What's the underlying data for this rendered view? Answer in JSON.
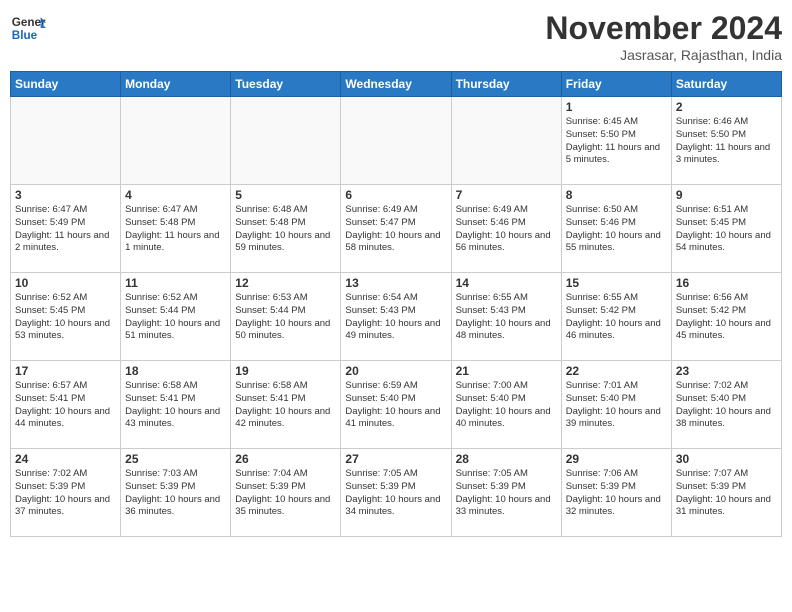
{
  "header": {
    "logo_line1": "General",
    "logo_line2": "Blue",
    "month": "November 2024",
    "location": "Jasrasar, Rajasthan, India"
  },
  "weekdays": [
    "Sunday",
    "Monday",
    "Tuesday",
    "Wednesday",
    "Thursday",
    "Friday",
    "Saturday"
  ],
  "weeks": [
    [
      {
        "day": "",
        "info": ""
      },
      {
        "day": "",
        "info": ""
      },
      {
        "day": "",
        "info": ""
      },
      {
        "day": "",
        "info": ""
      },
      {
        "day": "",
        "info": ""
      },
      {
        "day": "1",
        "info": "Sunrise: 6:45 AM\nSunset: 5:50 PM\nDaylight: 11 hours\nand 5 minutes."
      },
      {
        "day": "2",
        "info": "Sunrise: 6:46 AM\nSunset: 5:50 PM\nDaylight: 11 hours\nand 3 minutes."
      }
    ],
    [
      {
        "day": "3",
        "info": "Sunrise: 6:47 AM\nSunset: 5:49 PM\nDaylight: 11 hours\nand 2 minutes."
      },
      {
        "day": "4",
        "info": "Sunrise: 6:47 AM\nSunset: 5:48 PM\nDaylight: 11 hours\nand 1 minute."
      },
      {
        "day": "5",
        "info": "Sunrise: 6:48 AM\nSunset: 5:48 PM\nDaylight: 10 hours\nand 59 minutes."
      },
      {
        "day": "6",
        "info": "Sunrise: 6:49 AM\nSunset: 5:47 PM\nDaylight: 10 hours\nand 58 minutes."
      },
      {
        "day": "7",
        "info": "Sunrise: 6:49 AM\nSunset: 5:46 PM\nDaylight: 10 hours\nand 56 minutes."
      },
      {
        "day": "8",
        "info": "Sunrise: 6:50 AM\nSunset: 5:46 PM\nDaylight: 10 hours\nand 55 minutes."
      },
      {
        "day": "9",
        "info": "Sunrise: 6:51 AM\nSunset: 5:45 PM\nDaylight: 10 hours\nand 54 minutes."
      }
    ],
    [
      {
        "day": "10",
        "info": "Sunrise: 6:52 AM\nSunset: 5:45 PM\nDaylight: 10 hours\nand 53 minutes."
      },
      {
        "day": "11",
        "info": "Sunrise: 6:52 AM\nSunset: 5:44 PM\nDaylight: 10 hours\nand 51 minutes."
      },
      {
        "day": "12",
        "info": "Sunrise: 6:53 AM\nSunset: 5:44 PM\nDaylight: 10 hours\nand 50 minutes."
      },
      {
        "day": "13",
        "info": "Sunrise: 6:54 AM\nSunset: 5:43 PM\nDaylight: 10 hours\nand 49 minutes."
      },
      {
        "day": "14",
        "info": "Sunrise: 6:55 AM\nSunset: 5:43 PM\nDaylight: 10 hours\nand 48 minutes."
      },
      {
        "day": "15",
        "info": "Sunrise: 6:55 AM\nSunset: 5:42 PM\nDaylight: 10 hours\nand 46 minutes."
      },
      {
        "day": "16",
        "info": "Sunrise: 6:56 AM\nSunset: 5:42 PM\nDaylight: 10 hours\nand 45 minutes."
      }
    ],
    [
      {
        "day": "17",
        "info": "Sunrise: 6:57 AM\nSunset: 5:41 PM\nDaylight: 10 hours\nand 44 minutes."
      },
      {
        "day": "18",
        "info": "Sunrise: 6:58 AM\nSunset: 5:41 PM\nDaylight: 10 hours\nand 43 minutes."
      },
      {
        "day": "19",
        "info": "Sunrise: 6:58 AM\nSunset: 5:41 PM\nDaylight: 10 hours\nand 42 minutes."
      },
      {
        "day": "20",
        "info": "Sunrise: 6:59 AM\nSunset: 5:40 PM\nDaylight: 10 hours\nand 41 minutes."
      },
      {
        "day": "21",
        "info": "Sunrise: 7:00 AM\nSunset: 5:40 PM\nDaylight: 10 hours\nand 40 minutes."
      },
      {
        "day": "22",
        "info": "Sunrise: 7:01 AM\nSunset: 5:40 PM\nDaylight: 10 hours\nand 39 minutes."
      },
      {
        "day": "23",
        "info": "Sunrise: 7:02 AM\nSunset: 5:40 PM\nDaylight: 10 hours\nand 38 minutes."
      }
    ],
    [
      {
        "day": "24",
        "info": "Sunrise: 7:02 AM\nSunset: 5:39 PM\nDaylight: 10 hours\nand 37 minutes."
      },
      {
        "day": "25",
        "info": "Sunrise: 7:03 AM\nSunset: 5:39 PM\nDaylight: 10 hours\nand 36 minutes."
      },
      {
        "day": "26",
        "info": "Sunrise: 7:04 AM\nSunset: 5:39 PM\nDaylight: 10 hours\nand 35 minutes."
      },
      {
        "day": "27",
        "info": "Sunrise: 7:05 AM\nSunset: 5:39 PM\nDaylight: 10 hours\nand 34 minutes."
      },
      {
        "day": "28",
        "info": "Sunrise: 7:05 AM\nSunset: 5:39 PM\nDaylight: 10 hours\nand 33 minutes."
      },
      {
        "day": "29",
        "info": "Sunrise: 7:06 AM\nSunset: 5:39 PM\nDaylight: 10 hours\nand 32 minutes."
      },
      {
        "day": "30",
        "info": "Sunrise: 7:07 AM\nSunset: 5:39 PM\nDaylight: 10 hours\nand 31 minutes."
      }
    ]
  ]
}
